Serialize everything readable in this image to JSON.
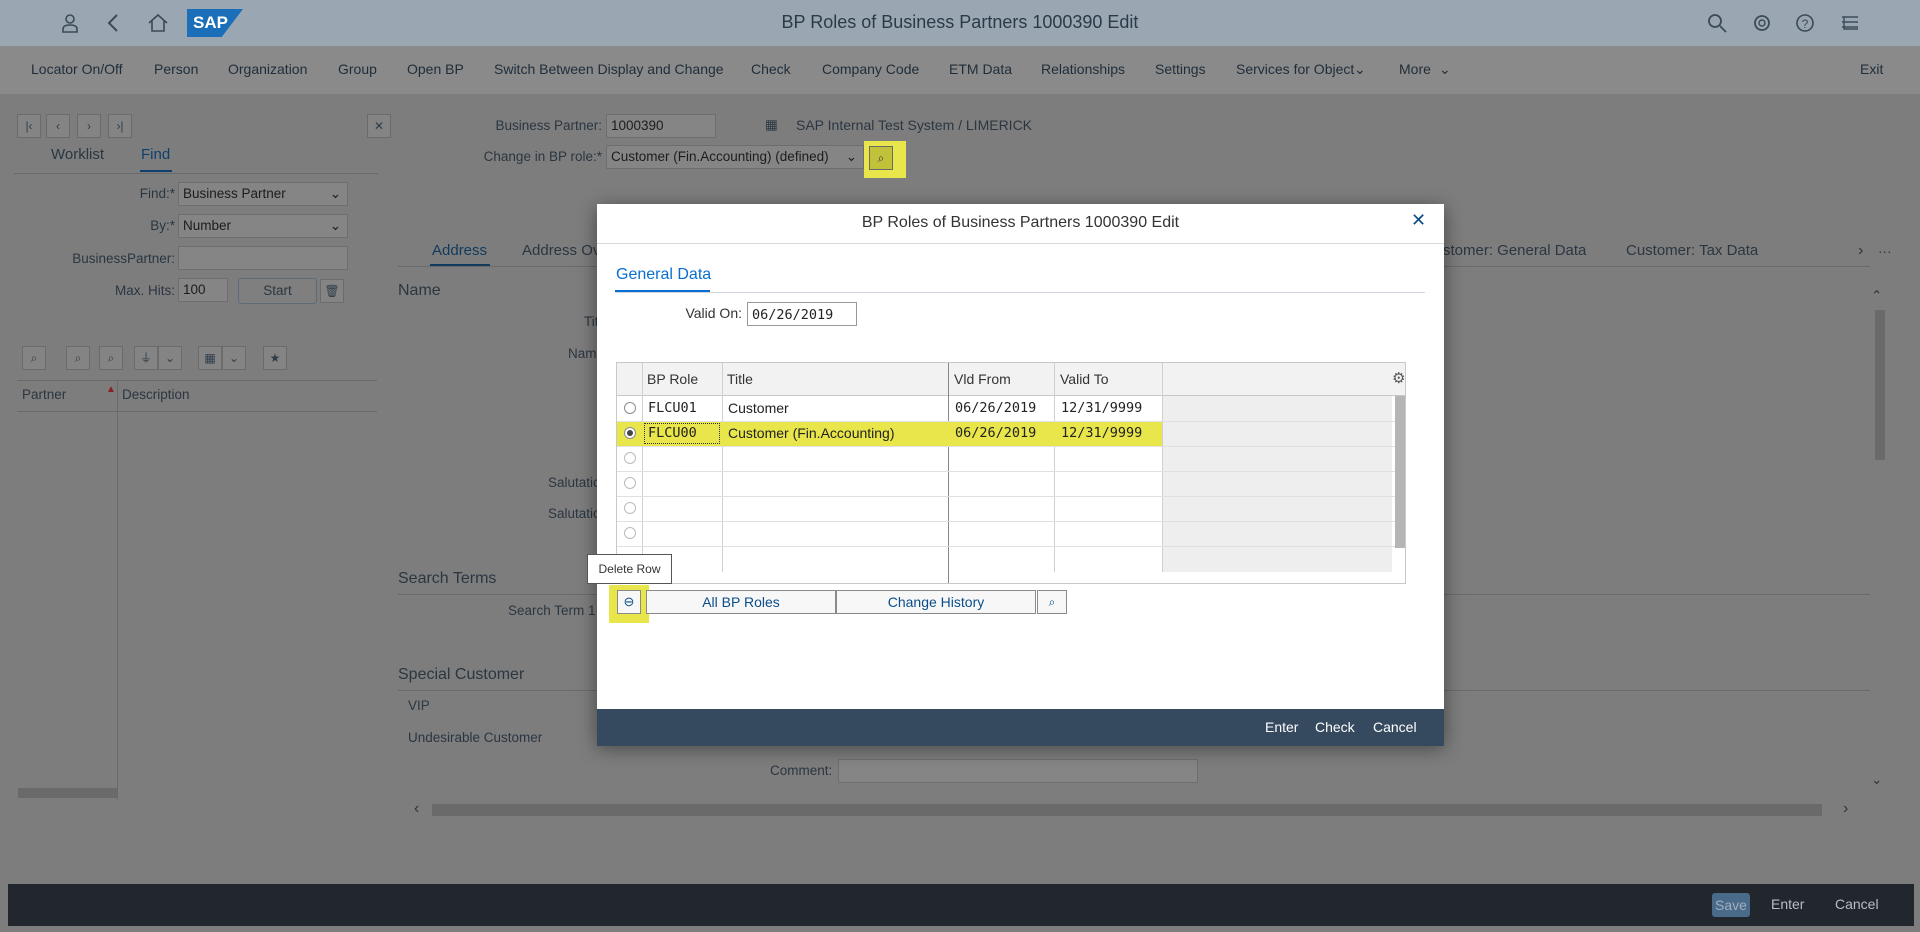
{
  "shell": {
    "title": "BP Roles of Business Partners 1000390 Edit",
    "logo": "SAP"
  },
  "menubar": {
    "items": [
      "Locator On/Off",
      "Person",
      "Organization",
      "Group",
      "Open BP",
      "Switch Between Display and Change",
      "Check",
      "Company Code",
      "ETM Data",
      "Relationships",
      "Settings",
      "Services for Object",
      "More"
    ],
    "exit": "Exit"
  },
  "left": {
    "tabs": [
      "Worklist",
      "Find"
    ],
    "find_label": "Find:*",
    "find_value": "Business Partner",
    "by_label": "By:*",
    "by_value": "Number",
    "bp_label": "BusinessPartner:",
    "bp_value": "",
    "maxhits_label": "Max. Hits:",
    "maxhits_value": "100",
    "start": "Start",
    "col_partner": "Partner",
    "col_description": "Description"
  },
  "header": {
    "bp_label": "Business Partner:",
    "bp_value": "1000390",
    "system": "SAP Internal Test System / LIMERICK",
    "role_label": "Change in BP role:*",
    "role_value": "Customer (Fin.Accounting) (defined)"
  },
  "main": {
    "tabs": [
      "Address",
      "Address Ov",
      "stomer: General Data",
      "Customer: Tax Data"
    ],
    "section_name": "Name",
    "frag_title": "Tit",
    "frag_name": "Nam",
    "frag_salut1": "Salutatio",
    "frag_salut2": "Salutatio",
    "section_search": "Search Terms",
    "search_term": "Search Term 1",
    "section_special": "Special Customer",
    "vip": "VIP",
    "undesirable": "Undesirable Customer",
    "comment_label": "Comment:"
  },
  "dialog": {
    "title": "BP Roles of Business Partners 1000390 Edit",
    "tab": "General Data",
    "valid_on_label": "Valid On:",
    "valid_on_value": "06/26/2019",
    "columns": [
      "BP Role",
      "Title",
      "Vld From",
      "Valid To"
    ],
    "rows": [
      {
        "role": "FLCU01",
        "title": "Customer",
        "from": "06/26/2019",
        "to": "12/31/9999",
        "selected": false
      },
      {
        "role": "FLCU00",
        "title": "Customer (Fin.Accounting)",
        "from": "06/26/2019",
        "to": "12/31/9999",
        "selected": true
      }
    ],
    "tooltip": "Delete Row",
    "btn_all_roles": "All BP Roles",
    "btn_history": "Change History",
    "footer": [
      "Enter",
      "Check",
      "Cancel"
    ]
  },
  "footer": {
    "save": "Save",
    "enter": "Enter",
    "cancel": "Cancel"
  },
  "colors": {
    "highlight": "#e8e64a",
    "shell": "#9aa7b3",
    "dialog_footer": "#354a5f",
    "link": "#0a6ed1"
  }
}
